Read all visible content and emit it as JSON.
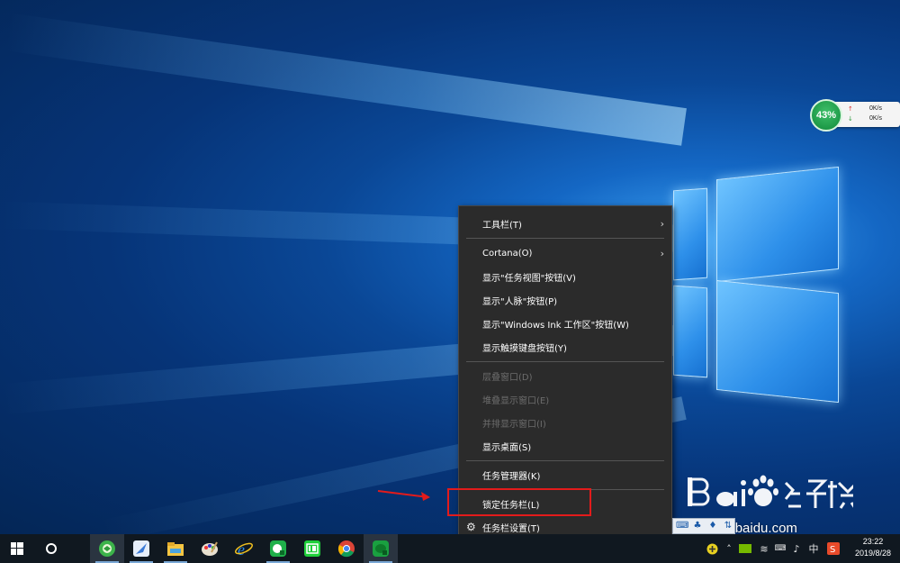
{
  "speed_widget": {
    "cpu_percent": "43%",
    "upload": "0K/s",
    "download": "0K/s",
    "plus": "+"
  },
  "context_menu": {
    "items": [
      {
        "label": "工具栏(T)",
        "enabled": true,
        "submenu": true
      },
      {
        "label": "Cortana(O)",
        "enabled": true,
        "submenu": true
      },
      {
        "label": "显示\"任务视图\"按钮(V)",
        "enabled": true
      },
      {
        "label": "显示\"人脉\"按钮(P)",
        "enabled": true
      },
      {
        "label": "显示\"Windows Ink 工作区\"按钮(W)",
        "enabled": true
      },
      {
        "label": "显示触摸键盘按钮(Y)",
        "enabled": true
      },
      {
        "label": "层叠窗口(D)",
        "enabled": false
      },
      {
        "label": "堆叠显示窗口(E)",
        "enabled": false
      },
      {
        "label": "并排显示窗口(I)",
        "enabled": false
      },
      {
        "label": "显示桌面(S)",
        "enabled": true
      },
      {
        "label": "任务管理器(K)",
        "enabled": true
      },
      {
        "label": "锁定任务栏(L)",
        "enabled": true
      },
      {
        "label": "任务栏设置(T)",
        "enabled": true,
        "icon": "gear-icon"
      }
    ],
    "submenu_glyph": "›",
    "gear_glyph": "⚙"
  },
  "watermark": {
    "url": "jingyan.baidu.com"
  },
  "taskbar": {
    "start_icon": "windows-logo-icon",
    "search_icon": "cortana-circle-icon",
    "apps": [
      {
        "name": "360-browser-icon"
      },
      {
        "name": "feather-app-icon"
      },
      {
        "name": "file-explorer-icon"
      },
      {
        "name": "paint-palette-icon"
      },
      {
        "name": "internet-explorer-icon"
      },
      {
        "name": "green-app-icon"
      },
      {
        "name": "iqiyi-icon"
      },
      {
        "name": "chrome-icon"
      },
      {
        "name": "green-chat-icon"
      }
    ],
    "tray": {
      "ime_label": "中",
      "clock_time": "23:22",
      "clock_date": "2019/8/28"
    }
  },
  "colors": {
    "menu_bg": "#2b2b2b",
    "highlight": "#e31b1b",
    "taskbar_bg": "#101820"
  }
}
